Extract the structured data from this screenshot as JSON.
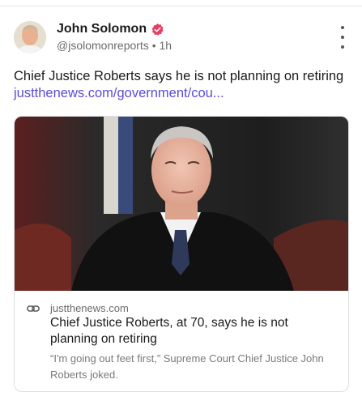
{
  "post": {
    "author_name": "John Solomon",
    "handle": "@jsolomonreports",
    "separator": "•",
    "time": "1h",
    "text": "Chief Justice Roberts says he is not planning on retiring",
    "link_text": "justthenews.com/government/cou..."
  },
  "card": {
    "domain": "justthenews.com",
    "title": "Chief Justice Roberts, at 70, says he is not planning on retiring",
    "description": "“I'm going out feet first,” Supreme Court Chief Justice John Roberts joked."
  },
  "icons": {
    "verified": "verified-badge-icon",
    "more": "more-vertical-icon",
    "link": "link-icon"
  },
  "colors": {
    "link": "#5b4bd6",
    "verified": "#e4405f"
  }
}
